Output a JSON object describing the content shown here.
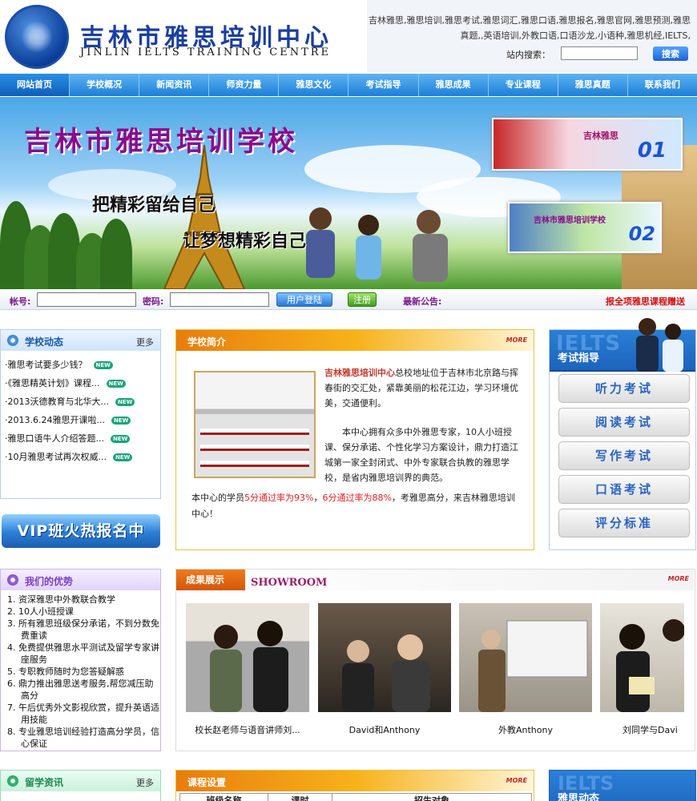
{
  "header": {
    "logo_cn": "吉林市雅思培训中心",
    "logo_en": "JINLIN  IELTS  TRAINING  CENTRE",
    "keywords": "吉林雅思,雅思培训,雅思考试,雅思词汇,雅思口语,雅思报名,雅思官网,雅思预测,雅思真题,,英语培训,外教口语,口语沙龙,小语种,雅思机经,IELTS,",
    "search_label": "站内搜索：",
    "search_value": "",
    "search_button": "搜索"
  },
  "nav": [
    "网站首页",
    "学校概况",
    "新闻资讯",
    "师资力量",
    "雅思文化",
    "考试指导",
    "雅思成果",
    "专业课程",
    "雅思真题",
    "联系我们"
  ],
  "banner": {
    "title": "吉林市雅思培训学校",
    "slogan1": "把精彩留给自己",
    "slogan2": "让梦想精彩自己",
    "ad1_text": "吉林雅思",
    "ad1_num": "01",
    "ad2_text": "吉林市雅思培训学校",
    "ad2_num": "02"
  },
  "login": {
    "account_label": "帐号:",
    "password_label": "密码:",
    "login_button": "用户登陆",
    "register_button": "注册",
    "notice_label": "最新公告:",
    "notice_text": "报全项雅思课程赠送"
  },
  "school_news": {
    "title": "学校动态",
    "more": "更多",
    "new_badge": "NEW",
    "items": [
      "·雅思考试要多少钱？",
      "·《雅思精英计划》课程...",
      "·2013沃德教育与北华大...",
      "·2013.6.24雅思开课啦...",
      "·雅思口语牛人介绍答题...",
      "·10月雅思考试再次权威..."
    ]
  },
  "vip_banner": "VIP班火热报名中",
  "intro": {
    "title": "学校简介",
    "more": "MORE",
    "name": "吉林雅思培训中心",
    "p1": "总校地址位于吉林市北京路与挥春街的交汇处，紧靠美丽的松花江边，学习环境优美，交通便利。",
    "p2": "本中心拥有众多中外雅思专家，10人小班授课、保分承诺、个性化学习方案设计，鼎力打造江城第一家全封闭式、中外专家联合执教的雅思学校，是省内雅思培训界的典范。",
    "p3_a": "本中心的学员",
    "p3_b": "5分通过率为93%",
    "p3_c": "，",
    "p3_d": "6分通过率为88%",
    "p3_e": "，考雅思高分，来吉林雅思培训中心！"
  },
  "exam_guide": {
    "ghost": "IELTS",
    "title": "考试指导",
    "items": [
      "听力考试",
      "阅读考试",
      "写作考试",
      "口语考试",
      "评分标准"
    ]
  },
  "advantages": {
    "title": "我们的优势",
    "items": [
      "1. 资深雅思中外教联合教学",
      "2. 10人小班授课",
      "3. 所有雅思班级保分承诺，不到分数免费重读",
      "4. 免费提供雅思水平测试及留学专家讲座服务",
      "5. 专职教师随时为您答疑解惑",
      "6. 鼎力推出雅思送考服务,帮您减压助高分",
      "7. 午后优秀外文影视欣赏，提升英语适用技能",
      "8. 专业雅思培训经验打造高分学员，信心保证"
    ]
  },
  "showroom": {
    "title": "成果展示",
    "en": "SHOWROOM",
    "more": "MORE",
    "captions": [
      "校长赵老师与语音讲师刘...",
      "David和Anthony",
      "外教Anthony",
      "刘同学与Davi"
    ]
  },
  "study_abroad": {
    "title": "留学资讯",
    "more": "更多"
  },
  "courses": {
    "title": "课程设置",
    "more": "MORE",
    "columns": [
      "班级名称",
      "课时",
      "招生对象"
    ]
  },
  "ielts_news": {
    "ghost": "IELTS",
    "title": "雅思动态"
  }
}
